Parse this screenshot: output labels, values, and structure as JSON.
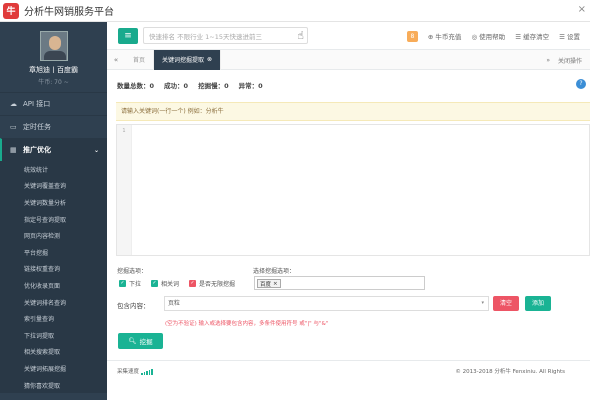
{
  "app": {
    "title": "分析牛网销服务平台",
    "logo_text": "牛"
  },
  "user": {
    "name": "章旭迪丨百度霸",
    "level": "牛币: 70 ~"
  },
  "sidebar": {
    "items": [
      {
        "icon": "cloud-icon",
        "label": "API 接口"
      },
      {
        "icon": "monitor-icon",
        "label": "定时任务"
      },
      {
        "icon": "grid-icon",
        "label": "推广优化"
      }
    ],
    "submenu": [
      "统效统计",
      "关键词覆盖查询",
      "关键词数量分析",
      "指定号查询提取",
      "网页内容检测",
      "平台挖掘",
      "链接权重查询",
      "优化收录页面",
      "关键词排名查询",
      "索引量查询",
      "下拉词提取",
      "相关搜索提取",
      "关键词拓展挖掘",
      "猜你喜欢提取"
    ]
  },
  "topbar": {
    "search_placeholder": "快速排名 不限行业 1~15天快速进前三",
    "badge": "8",
    "links": [
      "⊕ 牛币充值",
      "◎ 使用帮助",
      "☰ 缓存清空",
      "☰ 设置"
    ]
  },
  "tabs": {
    "home": "首页",
    "active": "关键词挖掘提取",
    "right": "关闭操作"
  },
  "stats": {
    "total": "数量总数：0",
    "success": "成功：0",
    "failed": "挖掘慢：0",
    "error": "异常：0"
  },
  "hint": "请输入关键词(一行一个) 例如：分析牛",
  "editor": {
    "line": "1"
  },
  "options": {
    "label": "挖掘选项：",
    "items": [
      {
        "label": "下拉",
        "color": "green"
      },
      {
        "label": "相关词",
        "color": "green"
      },
      {
        "label": "是否无限挖掘",
        "color": "red"
      }
    ]
  },
  "engine": {
    "label": "选择挖掘选项：",
    "tag": "百度"
  },
  "filter": {
    "label": "包含内容：",
    "value": "页粒",
    "clear": "清空",
    "add": "添加",
    "note": "(空为不验证) 输入或选择要包含内容，多条件使用符号 或\"|\" 与\"&\""
  },
  "mine_button": "挖掘",
  "footer": {
    "speed": "采集速度",
    "copyright": "© 2013-2018 分析牛 Fenxiniu. All Rights"
  }
}
